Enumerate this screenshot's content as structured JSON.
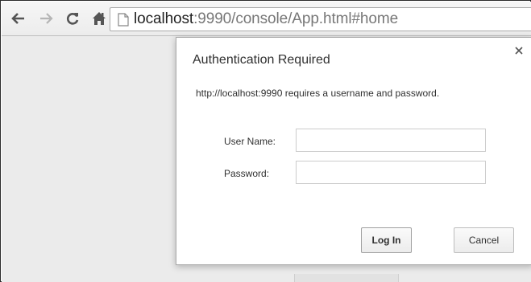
{
  "browser": {
    "url_host": "localhost",
    "url_rest": ":9990/console/App.html#home",
    "icons": {
      "back": "arrow-left-icon",
      "forward": "arrow-right-icon",
      "reload": "reload-icon",
      "home": "home-icon",
      "page": "page-icon"
    }
  },
  "dialog": {
    "title": "Authentication Required",
    "close_label": "×",
    "message": "http://localhost:9990 requires a username and password.",
    "username_label": "User Name:",
    "username_value": "",
    "password_label": "Password:",
    "password_value": "",
    "login_label": "Log In",
    "cancel_label": "Cancel"
  },
  "colors": {
    "content_bg": "#ebebeb",
    "dialog_bg": "#ffffff",
    "text": "#303030"
  }
}
